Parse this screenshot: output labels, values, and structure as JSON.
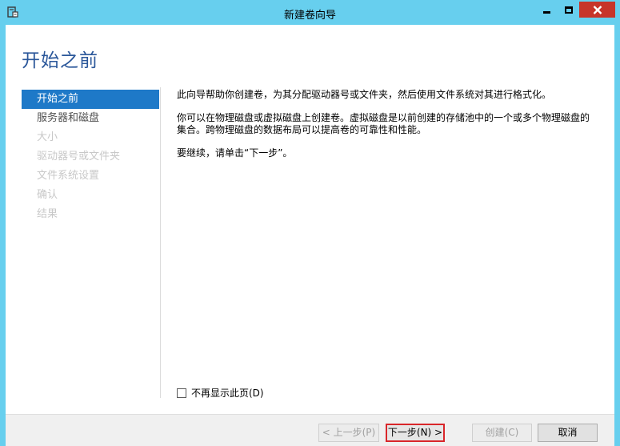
{
  "window": {
    "title": "新建卷向导",
    "accent_color": "#67cfee",
    "close_color": "#c7352a"
  },
  "page": {
    "title": "开始之前"
  },
  "nav": {
    "items": [
      {
        "label": "开始之前",
        "state": "active"
      },
      {
        "label": "服务器和磁盘",
        "state": "enabled"
      },
      {
        "label": "大小",
        "state": "disabled"
      },
      {
        "label": "驱动器号或文件夹",
        "state": "disabled"
      },
      {
        "label": "文件系统设置",
        "state": "disabled"
      },
      {
        "label": "确认",
        "state": "disabled"
      },
      {
        "label": "结果",
        "state": "disabled"
      }
    ]
  },
  "content": {
    "para1": "此向导帮助你创建卷，为其分配驱动器号或文件夹，然后使用文件系统对其进行格式化。",
    "para2": "你可以在物理磁盘或虚拟磁盘上创建卷。虚拟磁盘是以前创建的存储池中的一个或多个物理磁盘的集合。跨物理磁盘的数据布局可以提高卷的可靠性和性能。",
    "para3": "要继续，请单击“下一步”。"
  },
  "options": {
    "dont_show_label": "不再显示此页(D)",
    "dont_show_checked": false
  },
  "buttons": {
    "prev": "< 上一步(P)",
    "next": "下一步(N) >",
    "create": "创建(C)",
    "cancel": "取消"
  }
}
